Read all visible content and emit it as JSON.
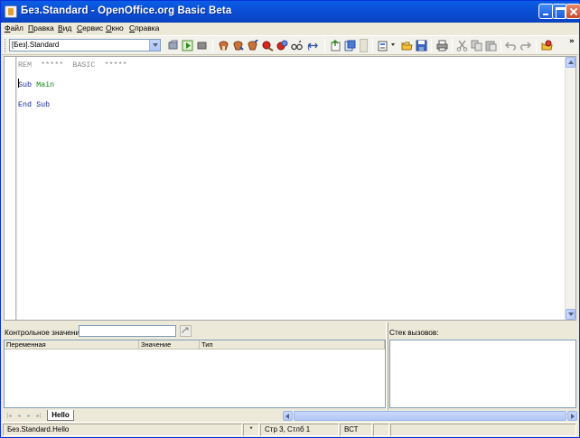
{
  "window": {
    "title": "Без.Standard - OpenOffice.org Basic Beta"
  },
  "menu": {
    "items": [
      {
        "underline": "Ф",
        "rest": "айл"
      },
      {
        "underline": "П",
        "rest": "равка"
      },
      {
        "underline": "В",
        "rest": "ид"
      },
      {
        "underline": "С",
        "rest": "ервис"
      },
      {
        "underline": "О",
        "rest": "кно"
      },
      {
        "underline": "С",
        "rest": "правка"
      }
    ]
  },
  "toolbar": {
    "library_select_value": "[Без].Standard",
    "overflow": "»"
  },
  "editor": {
    "lines": [
      {
        "parts": [
          {
            "t": "REM  *****  BASIC  *****",
            "c": "rem"
          }
        ]
      },
      {
        "parts": []
      },
      {
        "parts": [
          {
            "t": "Sub ",
            "c": "kw"
          },
          {
            "t": "Main",
            "c": "ident"
          }
        ]
      },
      {
        "parts": []
      },
      {
        "parts": [
          {
            "t": "End Sub",
            "c": "kw"
          }
        ]
      }
    ]
  },
  "watch": {
    "label": "Контрольное значение:",
    "input_value": "",
    "columns": [
      "Переменная",
      "Значение",
      "Тип"
    ]
  },
  "callstack": {
    "label": "Стек вызовов:"
  },
  "tabs": {
    "active": "Hello"
  },
  "status": {
    "module": "Без.Standard.Hello",
    "modified": "*",
    "position": "Стр 3, Стлб 1",
    "mode": "ВСТ"
  },
  "colors": {
    "keyword": "#1c2a9b",
    "identifier": "#0a8a0a",
    "comment": "#8a8a8a",
    "titlebar": "#0a50d8"
  }
}
